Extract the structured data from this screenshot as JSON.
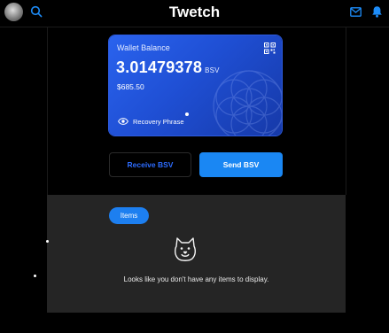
{
  "header": {
    "app_title": "Twetch"
  },
  "wallet": {
    "label": "Wallet Balance",
    "amount": "3.01479378",
    "currency": "BSV",
    "fiat_value": "$685.50",
    "recovery_label": "Recovery Phrase"
  },
  "actions": {
    "receive_label": "Receive BSV",
    "send_label": "Send BSV"
  },
  "items": {
    "tab_label": "Items",
    "empty_message": "Looks like you don't have any items to display."
  },
  "colors": {
    "background": "#000000",
    "card_gradient_start": "#2a63ee",
    "card_gradient_end": "#1639a8",
    "accent_blue": "#1a87f3",
    "receive_text": "#2d6cff",
    "panel_bg": "#252525"
  },
  "icons": [
    "avatar",
    "search-icon",
    "mail-icon",
    "bell-icon",
    "qr-code-icon",
    "eye-icon",
    "doge-icon"
  ]
}
